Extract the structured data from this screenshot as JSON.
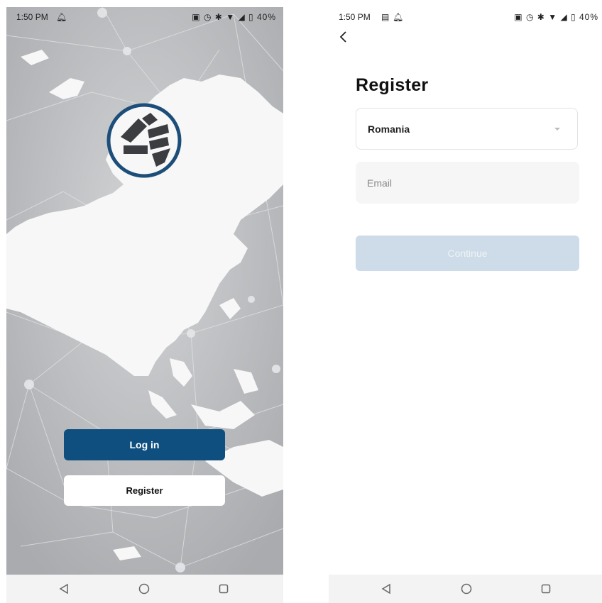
{
  "left_screen": {
    "status": {
      "time": "1:50 PM",
      "battery": "40%"
    },
    "login_label": "Log in",
    "register_label": "Register"
  },
  "right_screen": {
    "status": {
      "time": "1:50 PM",
      "battery": "40%"
    },
    "title": "Register",
    "country_value": "Romania",
    "email_placeholder": "Email",
    "continue_label": "Continue"
  },
  "colors": {
    "primary": "#0f4f7f",
    "continue_disabled": "#cddce8",
    "logo_ring": "#1d4e79",
    "logo_mark": "#3b3d40"
  },
  "icons": [
    "bell-icon",
    "nfc-icon",
    "alarm-icon",
    "bluetooth-icon",
    "wifi-icon",
    "signal-icon",
    "battery-icon",
    "back-arrow-icon",
    "dropdown-caret-icon",
    "nav-back-icon",
    "nav-home-icon",
    "nav-recents-icon",
    "gallery-icon"
  ]
}
